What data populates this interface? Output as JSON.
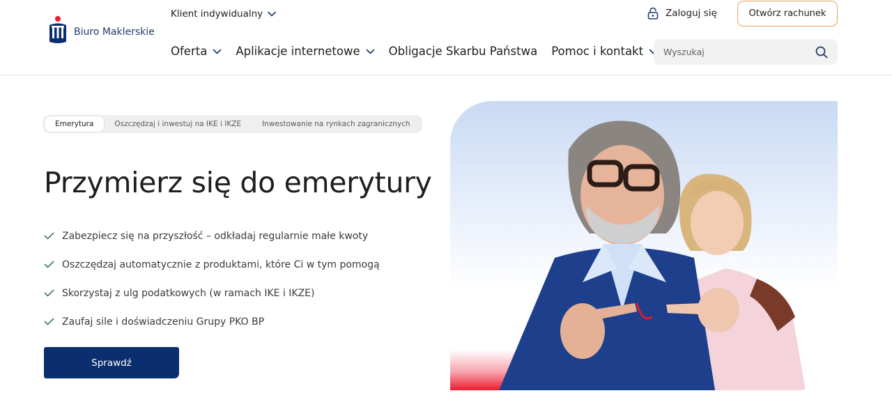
{
  "brand": {
    "name": "Biuro Maklerskie"
  },
  "header": {
    "client_type": "Klient indywidualny",
    "login_label": "Zaloguj się",
    "open_account_label": "Otwórz rachunek",
    "search_placeholder": "Wyszukaj",
    "nav": [
      {
        "label": "Oferta",
        "has_dropdown": true
      },
      {
        "label": "Aplikacje internetowe",
        "has_dropdown": true
      },
      {
        "label": "Obligacje Skarbu Państwa",
        "has_dropdown": false
      },
      {
        "label": "Pomoc i kontakt",
        "has_dropdown": true
      }
    ]
  },
  "hero": {
    "tabs": [
      {
        "label": "Emerytura",
        "active": true
      },
      {
        "label": "Oszczędzaj i inwestuj na IKE i IKZE",
        "active": false
      },
      {
        "label": "Inwestowanie na rynkach zagranicznych",
        "active": false
      }
    ],
    "title": "Przymierz się do emerytury",
    "benefits": [
      "Zabezpiecz się na przyszłość – odkładaj regularnie małe kwoty",
      "Oszczędzaj automatycznie z produktami, które Ci w tym pomogą",
      "Skorzystaj z ulg podatkowych (w ramach IKE i IKZE)",
      "Zaufaj sile i doświadczeniu Grupy PKO BP"
    ],
    "cta_label": "Sprawdź"
  },
  "colors": {
    "brand_navy": "#0b2f6e",
    "accent_orange": "#e7a063",
    "check_green": "#4a7f6a",
    "pko_red": "#ec1c2e"
  },
  "icons": {
    "logo": "pko-logo-icon",
    "chevron": "chevron-down-icon",
    "login": "padlock-icon",
    "search": "search-icon",
    "check": "check-icon"
  }
}
